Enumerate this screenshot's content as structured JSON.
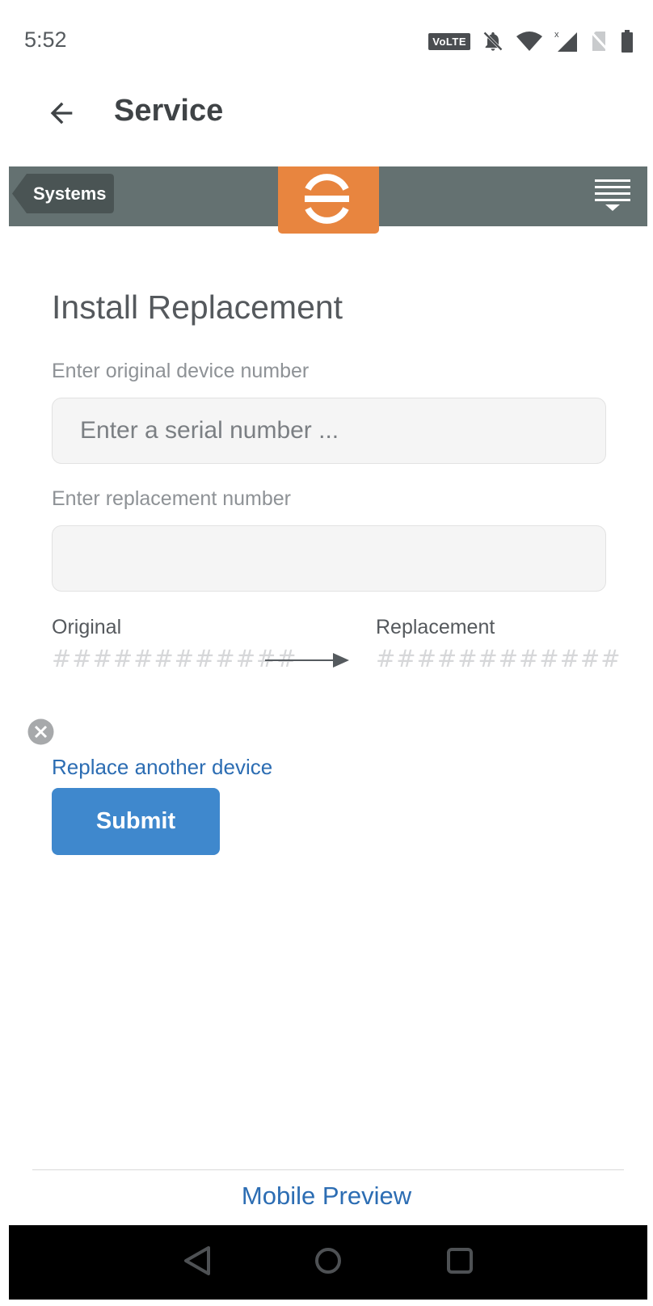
{
  "status_bar": {
    "time": "5:52",
    "network_badge": "VoLTE",
    "icons": [
      "volte-icon",
      "notifications-off-icon",
      "wifi-icon",
      "signal-icon",
      "no-sim-icon",
      "battery-icon"
    ]
  },
  "app_bar": {
    "title": "Service",
    "back_icon": "arrow-left-icon"
  },
  "brand_bar": {
    "systems_label": "Systems",
    "logo_icon": "enphase-logo-icon",
    "menu_icon": "hamburger-menu-icon",
    "bar_color": "#647171",
    "logo_color": "#e8853f"
  },
  "form": {
    "heading": "Install Replacement",
    "original_label": "Enter original device number",
    "original_placeholder": "Enter a serial number ...",
    "original_value": "",
    "replacement_label": "Enter replacement number",
    "replacement_placeholder": "",
    "replacement_value": ""
  },
  "summary": {
    "original_label": "Original",
    "original_value": "############",
    "replacement_label": "Replacement",
    "replacement_value": "############"
  },
  "actions": {
    "replace_another_link": "Replace another device",
    "submit_label": "Submit",
    "accent_color": "#3f88cd",
    "link_color": "#2c6db3"
  },
  "footer": {
    "text": "Mobile Preview"
  },
  "nav_bar": {
    "buttons": [
      "back-triangle-icon",
      "home-circle-icon",
      "recents-square-icon"
    ]
  }
}
